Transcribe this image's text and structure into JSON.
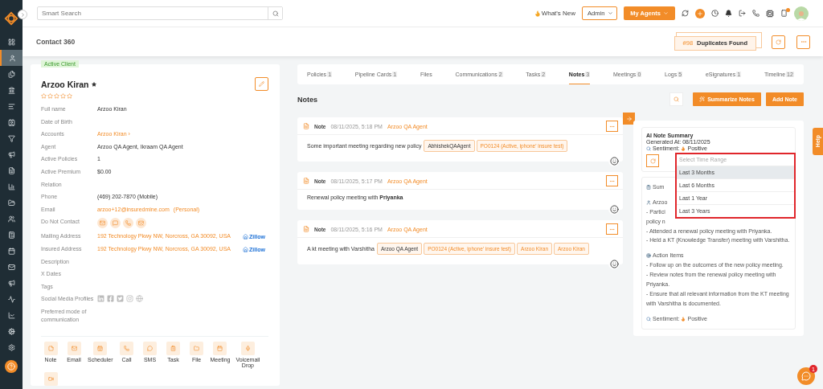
{
  "sidebar": {
    "items": [
      {
        "selected": false
      },
      {
        "selected": true
      },
      {
        "selected": false
      },
      {
        "selected": false
      },
      {
        "selected": false
      },
      {
        "selected": false
      },
      {
        "selected": false
      },
      {
        "selected": false
      },
      {
        "selected": false
      },
      {
        "selected": false
      },
      {
        "selected": false
      },
      {
        "selected": false
      },
      {
        "selected": false
      },
      {
        "selected": false
      },
      {
        "selected": false
      },
      {
        "selected": false
      },
      {
        "selected": false
      },
      {
        "selected": false
      },
      {
        "selected": false
      },
      {
        "selected": false
      }
    ]
  },
  "topbar": {
    "search_placeholder": "Smart Search",
    "whats_new": "What's New",
    "role": "Admin",
    "agents_button": "My Agents",
    "notification_dot": true
  },
  "header": {
    "title": "Contact 360",
    "duplicates_count": "#98",
    "duplicates_label": "Duplicates Found"
  },
  "contact": {
    "badge": "Active Client",
    "name": "Arzoo Kiran",
    "stars": 0,
    "fields": [
      {
        "kind": "text",
        "label": "Full name",
        "value": "Arzoo Kiran"
      },
      {
        "kind": "text",
        "label": "Date of Birth"
      },
      {
        "kind": "link",
        "label": "Accounts",
        "value": "Arzoo Kiran ›"
      },
      {
        "kind": "text",
        "label": "Agent",
        "value": "Arzoo QA Agent, Ikraam QA Agent"
      },
      {
        "kind": "text",
        "label": "Active Policies",
        "value": "1"
      },
      {
        "kind": "text",
        "label": "Active Premium",
        "value": "$0.00"
      },
      {
        "kind": "text",
        "label": "Relation"
      },
      {
        "kind": "text",
        "label": "Phone",
        "value": "(469) 202-7870 (Mobile)"
      },
      {
        "kind": "email",
        "label": "Email",
        "value": "arzoo+12@insuredmine.com",
        "note": "(Personal)"
      },
      {
        "kind": "contact_icons",
        "label": "Do Not Contact"
      },
      {
        "kind": "address",
        "label": "Mailing Address",
        "value": "192 Technology Pkwy NW, Norcross, GA 30092, USA",
        "badge": "Zillow"
      },
      {
        "kind": "address",
        "label": "Insured Address",
        "value": "192 Technology Pkwy NW, Norcross, GA 30092, USA",
        "badge": "Zillow"
      },
      {
        "kind": "text",
        "label": "Description"
      },
      {
        "kind": "text",
        "label": "X Dates"
      },
      {
        "kind": "text",
        "label": "Tags"
      },
      {
        "kind": "social",
        "label": "Social Media Profiles"
      },
      {
        "kind": "text",
        "label": "Preferred mode of communication"
      }
    ],
    "actions": [
      "Note",
      "Email",
      "Scheduler",
      "Call",
      "SMS",
      "Task",
      "File",
      "Meeting",
      "Voicemail Drop"
    ]
  },
  "tabs": [
    {
      "label": "Policies",
      "count": "1",
      "selected": false
    },
    {
      "label": "Pipeline Cards",
      "count": "1",
      "selected": false
    },
    {
      "label": "Files",
      "selected": false
    },
    {
      "label": "Communications",
      "count": "2",
      "selected": false
    },
    {
      "label": "Tasks",
      "count": "2",
      "selected": false
    },
    {
      "label": "Notes",
      "count": "3",
      "selected": true
    },
    {
      "label": "Meetings",
      "count": "0",
      "selected": false
    },
    {
      "label": "Logs",
      "count": "5",
      "selected": false
    },
    {
      "label": "eSignatures",
      "count": "1",
      "selected": false
    },
    {
      "label": "Timeline",
      "count": "12",
      "selected": false
    }
  ],
  "notes": {
    "title": "Notes",
    "summarize_button": "Summarize Notes",
    "add_button": "Add Note",
    "items": [
      {
        "type": "Note",
        "time": "08/11/2025, 5:18 PM",
        "author": "Arzoo QA Agent",
        "text": "Some important meeting regarding new policy",
        "tags": [
          {
            "kind": "agent",
            "label": "AbhishekQAAgent"
          },
          {
            "kind": "policy",
            "label": "PO0124 (Active,  iphone' insure test)"
          }
        ]
      },
      {
        "type": "Note",
        "time": "08/11/2025, 5:17 PM",
        "author": "Arzoo QA Agent",
        "text": "Renewal policy meeting with **Priyanka**"
      },
      {
        "type": "Note",
        "time": "08/11/2025, 5:16 PM",
        "author": "Arzoo QA Agent",
        "text": "A kt meeting with Varshitha",
        "tags": [
          {
            "kind": "agent",
            "label": "Arzoo QA Agent"
          },
          {
            "kind": "policy",
            "label": "PO0124 (Active,  iphone' insure test)"
          },
          {
            "kind": "policy",
            "label": "Arzoo Kiran"
          },
          {
            "kind": "policy",
            "label": "Arzoo Kiran"
          }
        ]
      }
    ]
  },
  "summary": {
    "title": "AI Note Summary",
    "generated": "Generated At: 08/11/2025",
    "sentiment_label": "Sentiment:",
    "sentiment": "Positive",
    "sections": [
      {
        "kind": "list",
        "heading": "Sum"
      },
      {
        "kind": "person",
        "heading": "Arzoo",
        "lines": [
          "- Partici",
          "policy n",
          "- Attended a renewal policy meeting with Priyanka.",
          "- Held a KT (Knowledge Transfer) meeting with Varshitha."
        ]
      },
      {
        "kind": "action",
        "heading": "Action Items",
        "lines": [
          "- Follow up on the outcomes of the new policy meeting.",
          "- Review notes from the renewal policy meeting with Priyanka.",
          "- Ensure that all relevant information from the KT meeting with Varshitha is documented."
        ]
      }
    ],
    "footer_label": "Sentiment:",
    "footer_value": "Positive"
  },
  "time_range": {
    "placeholder": "Select Time Range",
    "options": [
      {
        "label": "Last 3 Months",
        "selected": true
      },
      {
        "label": "Last 6 Months",
        "selected": false
      },
      {
        "label": "Last 1 Year",
        "selected": false
      },
      {
        "label": "Last 3 Years",
        "selected": false
      }
    ]
  },
  "help": "Help",
  "chat_badge": "1"
}
